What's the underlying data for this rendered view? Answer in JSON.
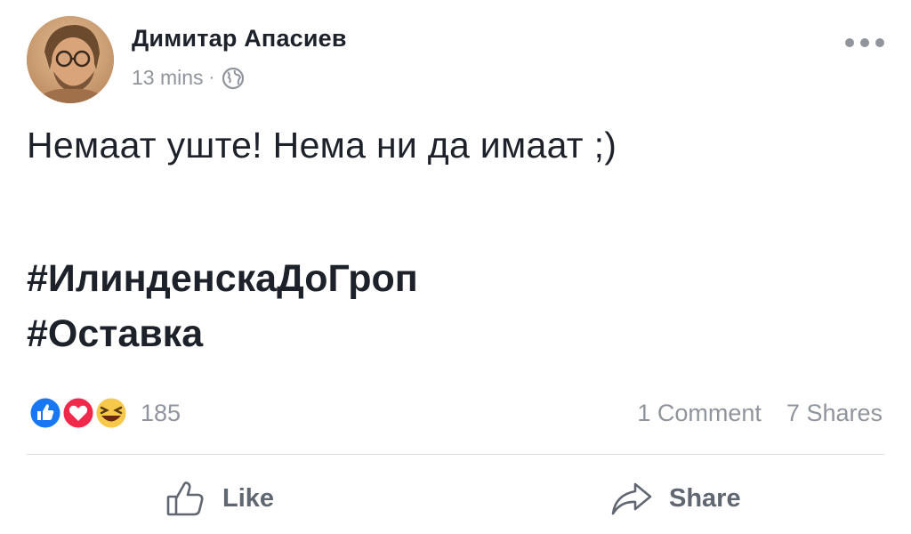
{
  "post": {
    "author": "Димитар Апасиев",
    "timestamp": "13 mins",
    "separator": "·",
    "privacy_icon": "globe-icon",
    "text": "Немаат уште! Нема ни да имаат ;)",
    "hashtags": [
      "#ИлинденскаДоГроп",
      "#Оставка"
    ]
  },
  "reactions": {
    "icons": [
      "like-reaction-icon",
      "love-reaction-icon",
      "haha-reaction-icon"
    ],
    "count": "185",
    "comments": "1 Comment",
    "shares": "7 Shares"
  },
  "actions": {
    "like_label": "Like",
    "share_label": "Share"
  },
  "colors": {
    "like_blue": "#1877f2",
    "love_red": "#f0284a",
    "haha_yellow": "#f7c94b",
    "secondary_text": "#90949c",
    "action_text": "#606770"
  }
}
